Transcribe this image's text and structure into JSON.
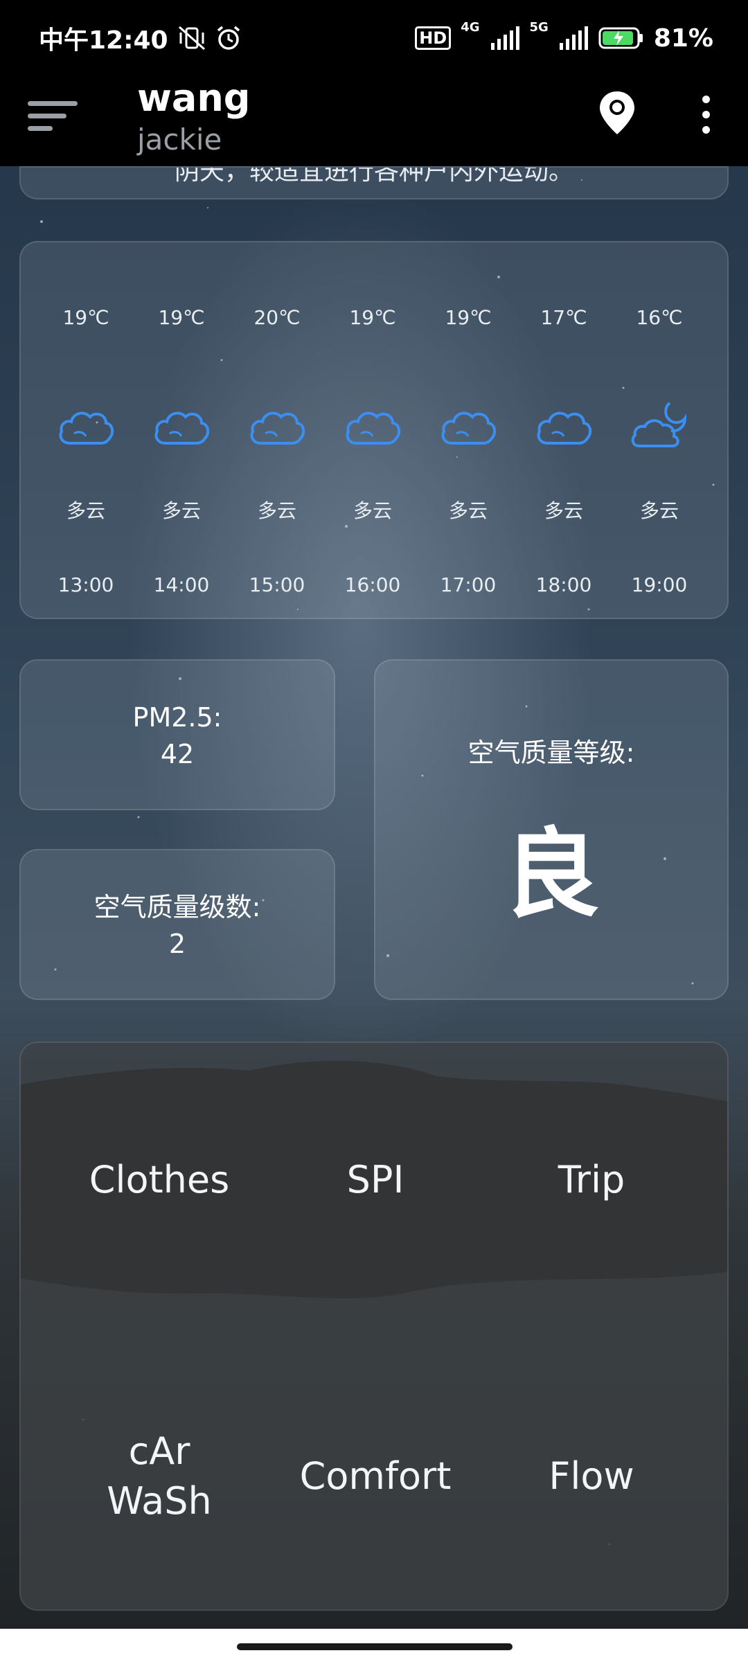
{
  "status_bar": {
    "time": "中午12:40",
    "network_hd": "HD",
    "network_4g": "4G",
    "network_5g": "5G",
    "battery": "81%"
  },
  "app_bar": {
    "title": "wang",
    "subtitle": "jackie"
  },
  "advice_card": {
    "text": "阴天，较适宜进行各种户内外运动。"
  },
  "hourly_forecast": [
    {
      "temp": "19℃",
      "condition": "多云",
      "time": "13:00",
      "icon": "cloudy-icon"
    },
    {
      "temp": "19℃",
      "condition": "多云",
      "time": "14:00",
      "icon": "cloudy-icon"
    },
    {
      "temp": "20℃",
      "condition": "多云",
      "time": "15:00",
      "icon": "cloudy-icon"
    },
    {
      "temp": "19℃",
      "condition": "多云",
      "time": "16:00",
      "icon": "cloudy-icon"
    },
    {
      "temp": "19℃",
      "condition": "多云",
      "time": "17:00",
      "icon": "cloudy-icon"
    },
    {
      "temp": "17℃",
      "condition": "多云",
      "time": "18:00",
      "icon": "cloudy-icon"
    },
    {
      "temp": "16℃",
      "condition": "多云",
      "time": "19:00",
      "icon": "partly-cloudy-night-icon"
    }
  ],
  "air_quality": {
    "pm25_label": "PM2.5:",
    "pm25_value": "42",
    "aqi_label": "空气质量级数:",
    "aqi_value": "2",
    "level_label": "空气质量等级:",
    "level_value": "良"
  },
  "index_grid": {
    "items": [
      "Clothes",
      "SPI",
      "Trip",
      "cAr",
      "WaSh",
      "Comfort",
      "Flow"
    ]
  },
  "colors": {
    "icon_blue": "#3b8ff0",
    "card_bg": "rgba(180,190,205,0.16)"
  }
}
